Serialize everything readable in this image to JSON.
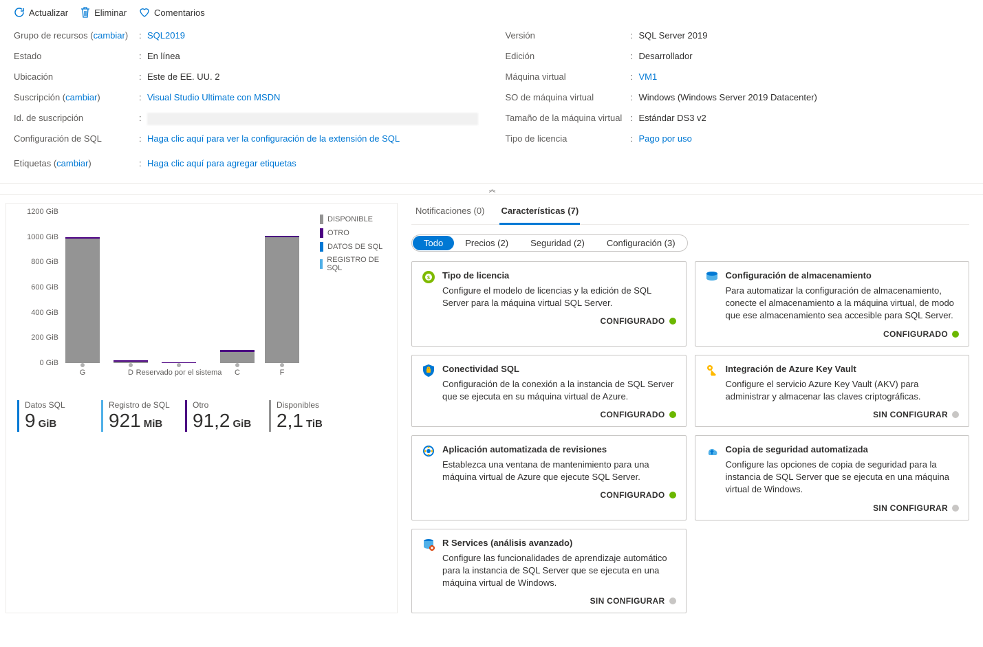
{
  "toolbar": {
    "refresh": "Actualizar",
    "delete": "Eliminar",
    "comments": "Comentarios"
  },
  "essentials": {
    "left": {
      "resource_group_label": "Grupo de recursos (",
      "resource_group_change": "cambiar",
      "resource_group_close": ") ",
      "resource_group_value": "SQL2019",
      "state_label": "Estado",
      "state_value": "En línea",
      "location_label": "Ubicación",
      "location_value": "Este de EE. UU. 2",
      "subscription_label": "Suscripción (",
      "subscription_change": "cambiar",
      "subscription_close": ")",
      "subscription_value": "Visual Studio Ultimate con MSDN",
      "sub_id_label": "Id. de suscripción",
      "sql_config_label": "Configuración de SQL",
      "sql_config_value": "Haga clic aquí para ver la configuración de la extensión de SQL",
      "tags_label": "Etiquetas (",
      "tags_change": "cambiar",
      "tags_close": ")",
      "tags_value": "Haga clic aquí para agregar etiquetas"
    },
    "right": {
      "version_label": "Versión",
      "version_value": "SQL Server 2019",
      "edition_label": "Edición",
      "edition_value": "Desarrollador",
      "vm_label": "Máquina virtual",
      "vm_value": "VM1",
      "vm_os_label": "SO de máquina virtual",
      "vm_os_value": "Windows (Windows Server 2019 Datacenter)",
      "vm_size_label": "Tamaño de la máquina virtual",
      "vm_size_value": "Estándar DS3 v2",
      "license_label": "Tipo de licencia",
      "license_value": "Pago por uso"
    }
  },
  "chart_data": {
    "type": "bar",
    "ylabel_unit": "GiB",
    "ylim": [
      0,
      1200
    ],
    "yticks": [
      "0 GiB",
      "200 GiB",
      "400 GiB",
      "600 GiB",
      "800 GiB",
      "1000 GiB",
      "1200 GiB"
    ],
    "categories": [
      "G",
      "D",
      "Reservado por el sistema",
      "C",
      "F"
    ],
    "series": [
      {
        "name": "DISPONIBLE",
        "color": "#949494",
        "values": [
          990,
          10,
          0,
          90,
          1000
        ]
      },
      {
        "name": "OTRO",
        "color": "#4b0082",
        "values": [
          10,
          10,
          5,
          15,
          10
        ]
      },
      {
        "name": "DATOS DE SQL",
        "color": "#0078d4",
        "values": [
          0,
          0,
          0,
          0,
          0
        ]
      },
      {
        "name": "REGISTRO DE SQL",
        "color": "#50b0e8",
        "values": [
          0,
          0,
          0,
          0,
          0
        ]
      }
    ],
    "legend": [
      "DISPONIBLE",
      "OTRO",
      "DATOS DE SQL",
      "REGISTRO DE SQL"
    ]
  },
  "stats": [
    {
      "label": "Datos SQL",
      "value": "9",
      "unit": "GiB",
      "color": "#0078d4"
    },
    {
      "label": "Registro de SQL",
      "value": "921",
      "unit": "MiB",
      "color": "#50b0e8"
    },
    {
      "label": "Otro",
      "value": "91,2",
      "unit": "GiB",
      "color": "#4b0082"
    },
    {
      "label": "Disponibles",
      "value": "2,1",
      "unit": "TiB",
      "color": "#949494"
    }
  ],
  "tabs": {
    "notifications": "Notificaciones (0)",
    "features": "Características (7)"
  },
  "pills": {
    "all": "Todo",
    "pricing": "Precios (2)",
    "security": "Seguridad (2)",
    "config": "Configuración (3)"
  },
  "cards": [
    {
      "icon": "license",
      "title": "Tipo de licencia",
      "desc": "Configure el modelo de licencias y la edición de SQL Server para la máquina virtual SQL Server.",
      "status": "CONFIGURADO",
      "dot": "green"
    },
    {
      "icon": "storage",
      "title": "Configuración de almacenamiento",
      "desc": "Para automatizar la configuración de almacenamiento, conecte el almacenamiento a la máquina virtual, de modo que ese almacenamiento sea accesible para SQL Server.",
      "status": "CONFIGURADO",
      "dot": "green"
    },
    {
      "icon": "shield",
      "title": "Conectividad SQL",
      "desc": "Configuración de la conexión a la instancia de SQL Server que se ejecuta en su máquina virtual de Azure.",
      "status": "CONFIGURADO",
      "dot": "green"
    },
    {
      "icon": "key",
      "title": "Integración de Azure Key Vault",
      "desc": "Configure el servicio Azure Key Vault (AKV) para administrar y almacenar las claves criptográficas.",
      "status": "SIN CONFIGURAR",
      "dot": "gray"
    },
    {
      "icon": "patch",
      "title": "Aplicación automatizada de revisiones",
      "desc": "Establezca una ventana de mantenimiento para una máquina virtual de Azure que ejecute SQL Server.",
      "status": "CONFIGURADO",
      "dot": "green"
    },
    {
      "icon": "backup",
      "title": "Copia de seguridad automatizada",
      "desc": "Configure las opciones de copia de seguridad para la instancia de SQL Server que se ejecuta en una máquina virtual de Windows.",
      "status": "SIN CONFIGURAR",
      "dot": "gray"
    },
    {
      "icon": "rservices",
      "title": "R Services (análisis avanzado)",
      "desc": "Configure las funcionalidades de aprendizaje automático para la instancia de SQL Server que se ejecuta en una máquina virtual de Windows.",
      "status": "SIN CONFIGURAR",
      "dot": "gray"
    }
  ]
}
